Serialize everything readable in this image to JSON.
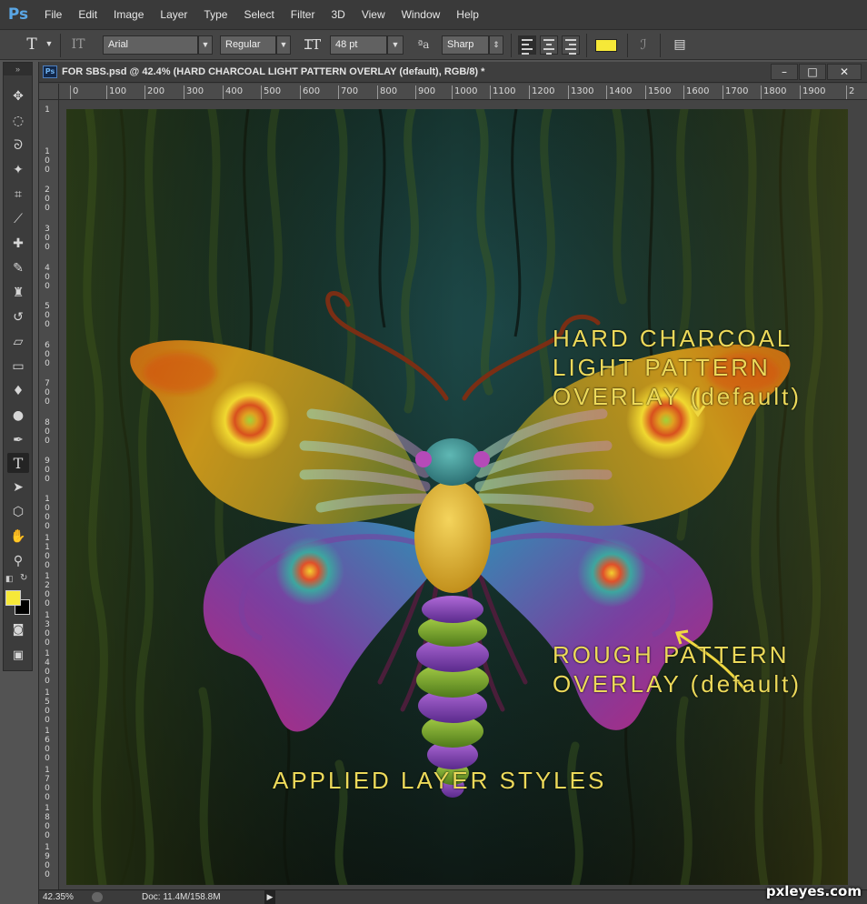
{
  "app": {
    "logo": "Ps",
    "menu": [
      "File",
      "Edit",
      "Image",
      "Layer",
      "Type",
      "Select",
      "Filter",
      "3D",
      "View",
      "Window",
      "Help"
    ]
  },
  "options": {
    "tool_glyph": "T",
    "font_family": "Arial",
    "font_style": "Regular",
    "font_size": "48 pt",
    "aa_glyph": "ªa",
    "antialias": "Sharp",
    "text_color": "#f6e838"
  },
  "document": {
    "title": "FOR SBS.psd @ 42.4% (HARD CHARCOAL LIGHT PATTERN OVERLAY (default), RGB/8) *",
    "ps_badge": "Ps",
    "minimize": "–",
    "maximize": "□",
    "close": "✕",
    "ruler_h": [
      "0",
      "100",
      "200",
      "300",
      "400",
      "500",
      "600",
      "700",
      "800",
      "900",
      "1000",
      "1100",
      "1200",
      "1300",
      "1400",
      "1500",
      "1600",
      "1700",
      "1800",
      "1900",
      "2"
    ],
    "ruler_v": [
      "1",
      "1 0 0",
      "2 0 0",
      "3 0 0",
      "4 0 0",
      "5 0 0",
      "6 0 0",
      "7 0 0",
      "8 0 0",
      "9 0 0",
      "1 0 0 0",
      "1 1 0 0",
      "1 2 0 0",
      "1 3 0 0",
      "1 4 0 0",
      "1 5 0 0",
      "1 6 0 0",
      "1 7 0 0",
      "1 8 0 0",
      "1 9 0 0"
    ],
    "zoom": "42.35%",
    "doc_size": "Doc: 11.4M/158.8M",
    "status_arrow": "▶"
  },
  "canvas": {
    "annotation_top": [
      "HARD CHARCOAL",
      "LIGHT PATTERN",
      "OVERLAY (default)"
    ],
    "annotation_right": [
      "ROUGH PATTERN",
      "OVERLAY (default)"
    ],
    "annotation_bottom": "APPLIED LAYER STYLES"
  },
  "toolbox": {
    "grip": "»",
    "tools": [
      {
        "name": "move-tool-icon",
        "glyph": "✥"
      },
      {
        "name": "marquee-tool-icon",
        "glyph": "◌"
      },
      {
        "name": "lasso-tool-icon",
        "glyph": "ᘐ"
      },
      {
        "name": "magic-wand-tool-icon",
        "glyph": "✦"
      },
      {
        "name": "crop-tool-icon",
        "glyph": "⌗"
      },
      {
        "name": "eyedropper-tool-icon",
        "glyph": "⟋"
      },
      {
        "name": "healing-brush-tool-icon",
        "glyph": "✚"
      },
      {
        "name": "brush-tool-icon",
        "glyph": "✎"
      },
      {
        "name": "stamp-tool-icon",
        "glyph": "♜"
      },
      {
        "name": "history-brush-tool-icon",
        "glyph": "↺"
      },
      {
        "name": "eraser-tool-icon",
        "glyph": "▱"
      },
      {
        "name": "gradient-tool-icon",
        "glyph": "▭"
      },
      {
        "name": "blur-tool-icon",
        "glyph": "♦"
      },
      {
        "name": "dodge-tool-icon",
        "glyph": "●"
      },
      {
        "name": "pen-tool-icon",
        "glyph": "✒"
      },
      {
        "name": "type-tool-icon",
        "glyph": "T"
      },
      {
        "name": "path-selection-tool-icon",
        "glyph": "➤"
      },
      {
        "name": "shape-tool-icon",
        "glyph": "⬡"
      },
      {
        "name": "hand-tool-icon",
        "glyph": "✋"
      },
      {
        "name": "zoom-tool-icon",
        "glyph": "⚲"
      }
    ],
    "mode_glyph": "◙",
    "screen_glyph": "▣",
    "foreground_color": "#f6e838",
    "background_color": "#000000"
  },
  "watermark": "pxleyes.com"
}
